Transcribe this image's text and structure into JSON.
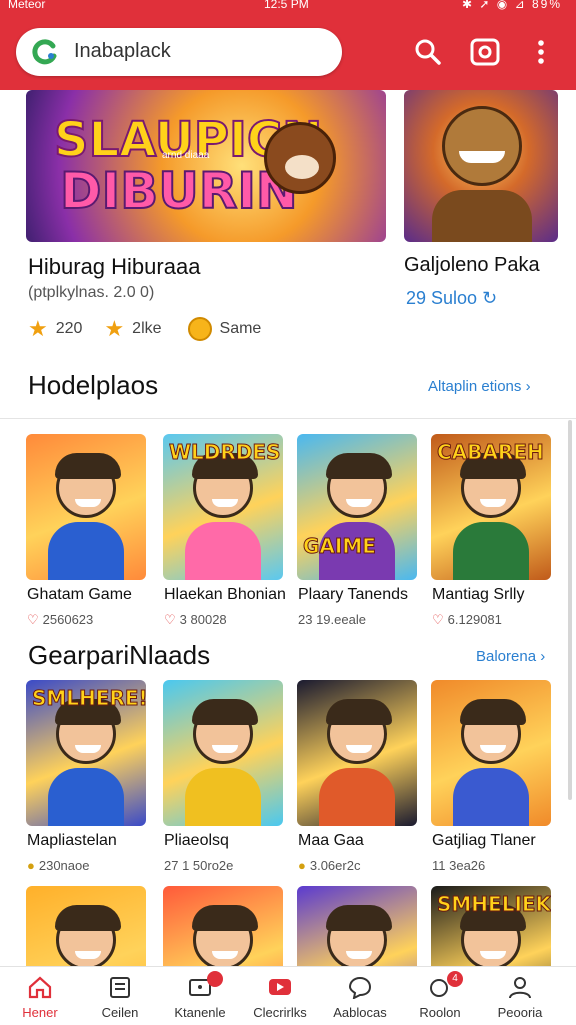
{
  "status": {
    "carrier": "Meteor",
    "time": "12:5 PM",
    "icons": "✱ ➚ ◉ ⊿ 89%"
  },
  "search": {
    "value": "Inabaplack"
  },
  "featured": [
    {
      "banner_line1": "SLAUPICN",
      "banner_small": "arnd diaaa",
      "banner_line2": "DIBURIN",
      "title": "Hiburag  Hiburaaa",
      "subtitle": "(ptplkylnas. 2.0 0)",
      "meta": [
        {
          "icon": "star-icon",
          "text": "220"
        },
        {
          "icon": "star-icon",
          "text": "2lke"
        },
        {
          "icon": "coin-icon",
          "text": "Same"
        }
      ]
    },
    {
      "title": "Galjoleno Paka",
      "subtitle": "29 Suloo",
      "subtitle_icon": "download-icon"
    }
  ],
  "sections": [
    {
      "title": "Hodelplaos",
      "link": "Altaplin etions",
      "tiles": [
        {
          "name": "Ghatam Game",
          "meta": "2560623",
          "meta_icon": "heart-icon",
          "banner": "",
          "bg": "#ff8a3a",
          "torso": "#2a5fd0"
        },
        {
          "name": "Hlaekan Bhonian",
          "meta": "3 80028",
          "meta_icon": "heart-icon",
          "banner": "WLDRDES",
          "bg": "#5ac8f0",
          "torso": "#ff6aa8"
        },
        {
          "name": "Plaary Tanends",
          "meta": "23 19.eeale",
          "meta_icon": "",
          "banner": "GAIME",
          "bg": "#4ab8f0",
          "torso": "#7a3ab0"
        },
        {
          "name": "Mantiag Srlly",
          "meta": "6.129081",
          "meta_icon": "heart-icon",
          "banner": "CABAREH",
          "bg": "#c05a1a",
          "torso": "#2a7a3a"
        }
      ]
    },
    {
      "title": "GearpariNlaads",
      "link": "Balorena",
      "tiles": [
        {
          "name": "Mapliastelan",
          "meta": "230naoe",
          "meta_icon": "coin-icon",
          "banner": "SMLHERE!",
          "bg": "#3a4ac8",
          "torso": "#2a5fd0"
        },
        {
          "name": "Pliaeolsq",
          "meta": "27 1 50ro2e",
          "meta_icon": "",
          "banner": "",
          "bg": "#4ac8f0",
          "torso": "#f0c020"
        },
        {
          "name": "Maa Gaa",
          "meta": "3.06er2c",
          "meta_icon": "coin-icon",
          "banner": "",
          "bg": "#1a1a30",
          "torso": "#e05a2a"
        },
        {
          "name": "Gatjliag Tlaner",
          "meta": "11 3ea26",
          "meta_icon": "",
          "banner": "",
          "bg": "#f08a2a",
          "torso": "#3a5ad0"
        }
      ]
    },
    {
      "tiles": [
        {
          "bg": "#ffb02a",
          "torso": "#2a7ad0",
          "banner": ""
        },
        {
          "bg": "#ff5a3a",
          "torso": "#d03030",
          "banner": ""
        },
        {
          "bg": "#5a3ad0",
          "torso": "#2a4ad0",
          "banner": ""
        },
        {
          "bg": "#1a1a1a",
          "torso": "#e05a2a",
          "banner": "SMHELIEK"
        }
      ]
    }
  ],
  "nav": [
    {
      "label": "Hener",
      "icon": "home-icon",
      "active": true
    },
    {
      "label": "Ceilen",
      "icon": "list-icon"
    },
    {
      "label": "Ktanenle",
      "icon": "tv-icon",
      "badge": ""
    },
    {
      "label": "Clecrirlks",
      "icon": "video-icon"
    },
    {
      "label": "Aablocas",
      "icon": "chat-icon"
    },
    {
      "label": "Roolon",
      "icon": "bell-icon",
      "badge": "4"
    },
    {
      "label": "Peooria",
      "icon": "person-icon"
    }
  ],
  "colors": {
    "accent": "#e0303a",
    "link": "#2a7fd0"
  }
}
